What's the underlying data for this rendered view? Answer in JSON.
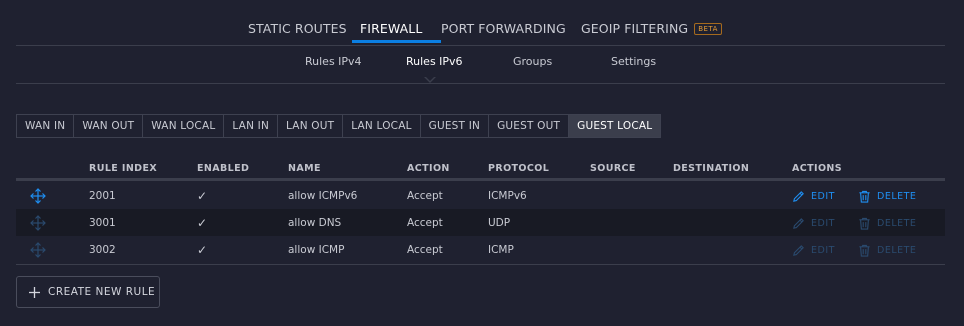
{
  "top_tabs": [
    {
      "label": "STATIC ROUTES",
      "active": false
    },
    {
      "label": "FIREWALL",
      "active": true
    },
    {
      "label": "PORT FORWARDING",
      "active": false
    },
    {
      "label": "GEOIP FILTERING",
      "active": false,
      "badge": "BETA"
    }
  ],
  "sub_tabs": [
    {
      "label": "Rules IPv4",
      "active": false
    },
    {
      "label": "Rules IPv6",
      "active": true
    },
    {
      "label": "Groups",
      "active": false
    },
    {
      "label": "Settings",
      "active": false
    }
  ],
  "chains": [
    {
      "label": "WAN IN",
      "active": false
    },
    {
      "label": "WAN OUT",
      "active": false
    },
    {
      "label": "WAN LOCAL",
      "active": false
    },
    {
      "label": "LAN IN",
      "active": false
    },
    {
      "label": "LAN OUT",
      "active": false
    },
    {
      "label": "LAN LOCAL",
      "active": false
    },
    {
      "label": "GUEST IN",
      "active": false
    },
    {
      "label": "GUEST OUT",
      "active": false
    },
    {
      "label": "GUEST LOCAL",
      "active": true
    }
  ],
  "table": {
    "headers": {
      "rule_index": "RULE INDEX",
      "enabled": "ENABLED",
      "name": "NAME",
      "action": "ACTION",
      "protocol": "PROTOCOL",
      "source": "SOURCE",
      "destination": "DESTINATION",
      "actions": "ACTIONS"
    },
    "rows": [
      {
        "rule_index": "2001",
        "enabled": "✓",
        "name": "allow ICMPv6",
        "action": "Accept",
        "protocol": "ICMPv6",
        "source": "",
        "destination": "",
        "edit_label": "EDIT",
        "delete_label": "DELETE",
        "actions_enabled": true
      },
      {
        "rule_index": "3001",
        "enabled": "✓",
        "name": "allow DNS",
        "action": "Accept",
        "protocol": "UDP",
        "source": "",
        "destination": "",
        "edit_label": "EDIT",
        "delete_label": "DELETE",
        "actions_enabled": false
      },
      {
        "rule_index": "3002",
        "enabled": "✓",
        "name": "allow ICMP",
        "action": "Accept",
        "protocol": "ICMP",
        "source": "",
        "destination": "",
        "edit_label": "EDIT",
        "delete_label": "DELETE",
        "actions_enabled": false
      }
    ]
  },
  "create_button": {
    "label": "CREATE NEW RULE",
    "icon": "plus-icon"
  },
  "colors": {
    "background": "#1f2130",
    "accent": "#0b7fe3",
    "badge": "#e39a35",
    "link": "#1f8ef1",
    "link_disabled": "#2a4a6e"
  }
}
